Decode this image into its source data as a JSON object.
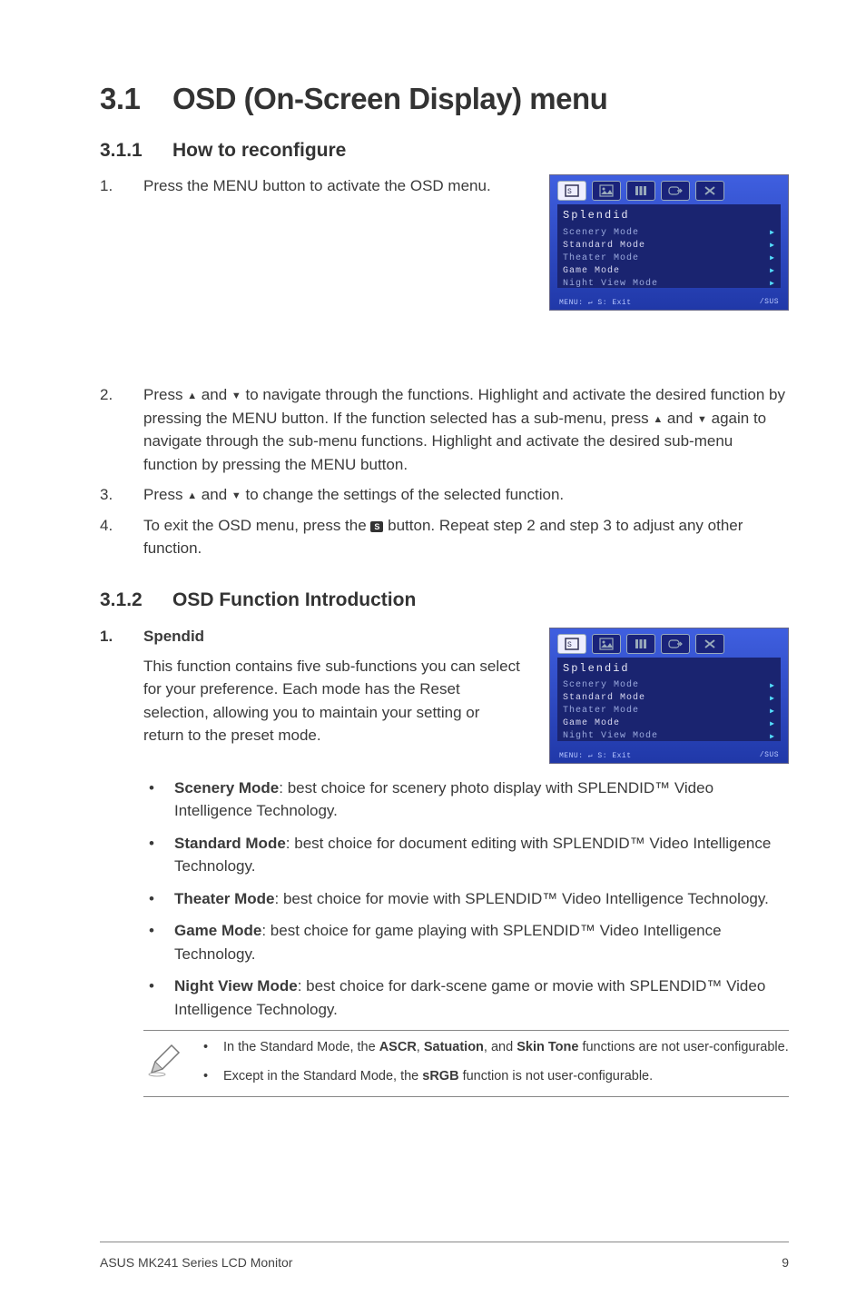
{
  "heading": {
    "num": "3.1",
    "title": "OSD (On-Screen Display) menu"
  },
  "sec311": {
    "num": "3.1.1",
    "title": "How to reconfigure"
  },
  "step1": {
    "n": "1.",
    "t": "Press the MENU button to activate the OSD menu."
  },
  "osd": {
    "title": "Splendid",
    "lines": [
      "Scenery Mode",
      "Standard Mode",
      "Theater Mode",
      "Game Mode",
      "Night View Mode"
    ],
    "foot_left": "MENU: ↵   S: Exit",
    "foot_right": "/SUS"
  },
  "step2": {
    "n": "2.",
    "pre": "Press ",
    "mid1": " and ",
    "mid2": " to navigate through the functions. Highlight and activate the desired function by pressing the MENU button. If the function selected has a sub-menu, press ",
    "mid3": " and ",
    "mid4": " again to navigate through the sub-menu functions. Highlight and activate the desired sub-menu function by pressing the MENU button."
  },
  "step3": {
    "n": "3.",
    "pre": "Press ",
    "mid1": " and ",
    "post": " to change the settings of the selected function."
  },
  "step4": {
    "n": "4.",
    "pre": "To exit the OSD menu, press the ",
    "post": " button. Repeat step 2 and step 3 to adjust any other function."
  },
  "sec312": {
    "num": "3.1.2",
    "title": "OSD Function Introduction"
  },
  "spendid": {
    "n": "1.",
    "label": "Spendid"
  },
  "spendid_para": "This function contains five sub-functions you can select for your preference. Each mode has the Reset selection, allowing you to maintain your setting or return to the preset mode.",
  "bullets": [
    {
      "bold": "Scenery Mode",
      "rest": ": best choice for scenery photo display with SPLENDID™ Video Intelligence Technology."
    },
    {
      "bold": "Standard Mode",
      "rest": ": best choice for document editing with SPLENDID™ Video Intelligence Technology."
    },
    {
      "bold": "Theater Mode",
      "rest": ": best choice for movie with SPLENDID™ Video Intelligence Technology."
    },
    {
      "bold": "Game Mode",
      "rest": ": best choice for game playing with SPLENDID™ Video Intelligence Technology."
    },
    {
      "bold": "Night View Mode",
      "rest": ": best choice for dark-scene game or movie with SPLENDID™ Video Intelligence Technology."
    }
  ],
  "notes": [
    {
      "pre": "In the Standard Mode, the ",
      "b1": "ASCR",
      "s1": ", ",
      "b2": "Satuation",
      "s2": ", and ",
      "b3": "Skin Tone",
      "post": " functions are not user-configurable."
    },
    {
      "pre": "Except in the Standard Mode, the ",
      "b1": "sRGB",
      "post": " function is not user-configurable."
    }
  ],
  "footer": {
    "left": "ASUS MK241 Series LCD Monitor",
    "right": "9"
  },
  "glyphs": {
    "up": "▲",
    "down": "▼",
    "s": "S",
    "dot": "•"
  }
}
